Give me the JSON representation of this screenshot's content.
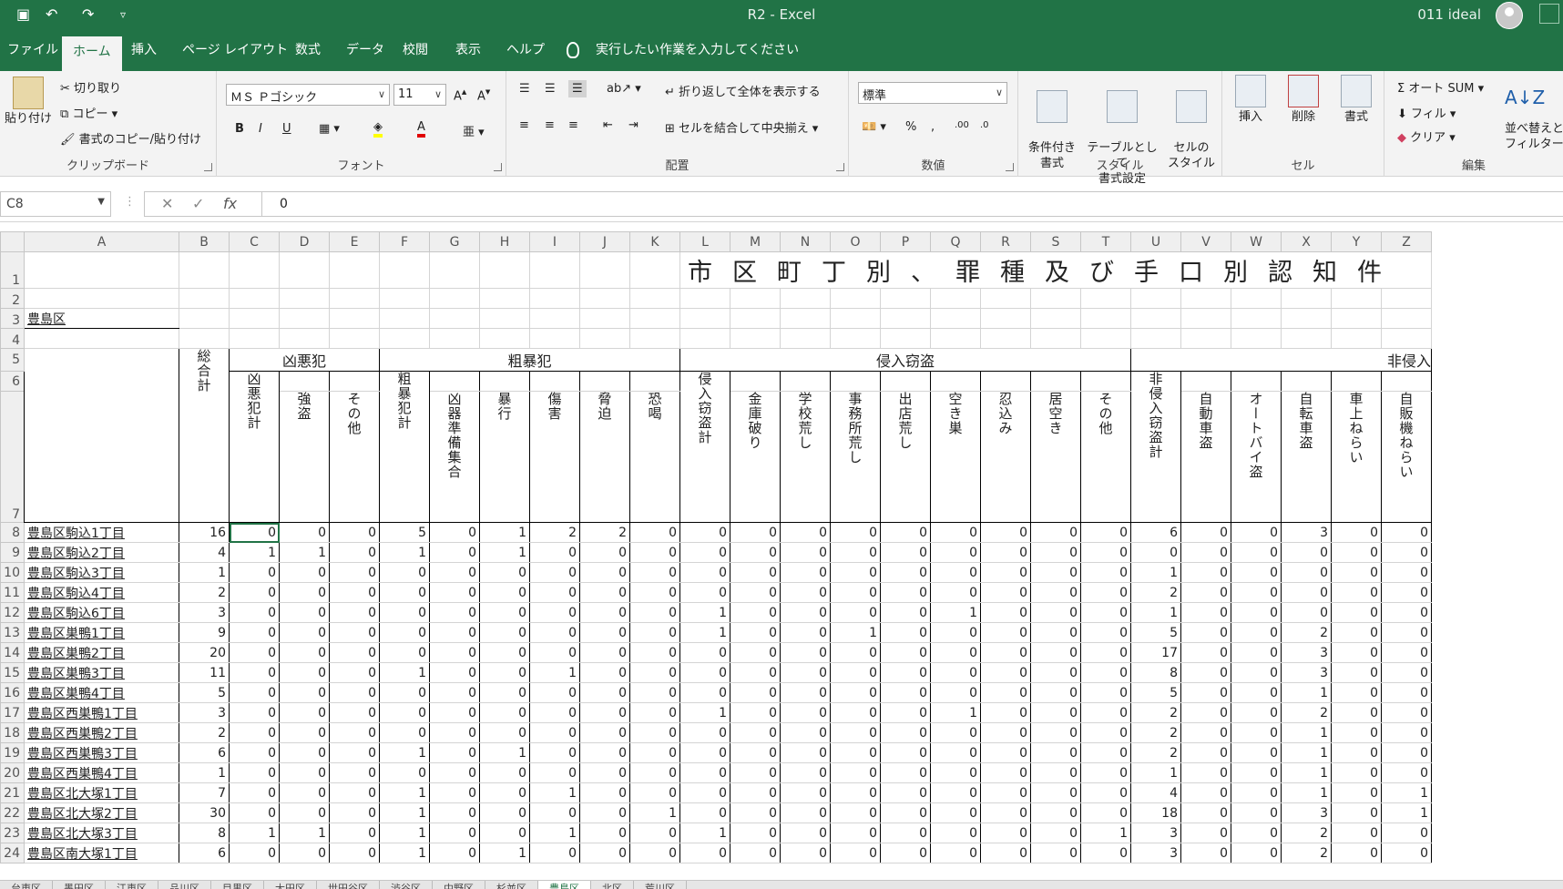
{
  "titlebar": {
    "doc_title": "R2  -  Excel",
    "account": "011 ideal",
    "colors": {
      "bg": "#217346"
    }
  },
  "tabs": [
    "ファイル",
    "ホーム",
    "挿入",
    "ページ レイアウト",
    "数式",
    "データ",
    "校閲",
    "表示",
    "ヘルプ"
  ],
  "tell_me": "実行したい作業を入力してください",
  "ribbon": {
    "clipboard": {
      "paste": "貼り付け",
      "cut": "切り取り",
      "copy": "コピー",
      "format_painter": "書式のコピー/貼り付け",
      "label": "クリップボード"
    },
    "font": {
      "name": "ＭＳ Ｐゴシック",
      "size": "11",
      "bold": "B",
      "italic": "I",
      "underline": "U",
      "label": "フォント"
    },
    "alignment": {
      "wrap": "折り返して全体を表示する",
      "merge": "セルを結合して中央揃え",
      "label": "配置"
    },
    "number": {
      "format": "標準",
      "label": "数値"
    },
    "styles": {
      "conditional": "条件付き\n書式",
      "table": "テーブルとして\n書式設定",
      "cell": "セルの\nスタイル",
      "label": "スタイル"
    },
    "cells": {
      "insert": "挿入",
      "delete": "削除",
      "format": "書式",
      "label": "セル"
    },
    "editing": {
      "autosum": "オート SUM",
      "fill": "フィル",
      "clear": "クリア",
      "sort": "並べ替えと\nフィルター",
      "label": "編集"
    }
  },
  "formula_bar": {
    "name_box": "C8",
    "value": "0"
  },
  "grid": {
    "columns": [
      "A",
      "B",
      "C",
      "D",
      "E",
      "F",
      "G",
      "H",
      "I",
      "J",
      "K",
      "L",
      "M",
      "N",
      "O",
      "P",
      "Q",
      "R",
      "S",
      "T",
      "U",
      "V",
      "W",
      "X",
      "Y",
      "Z"
    ],
    "title": "市区町丁別、罪種及び手口別認知件",
    "ward": "豊島区",
    "groups": {
      "kyoaku": "凶悪犯",
      "sobo": "粗暴犯",
      "shinnyu": "侵入窃盗",
      "hishinnyu": "非侵入"
    },
    "sougoukei": "総合計",
    "subheaders": {
      "C": "凶悪犯計",
      "D": "強盗",
      "E": "その他",
      "F": "粗暴犯計",
      "G": "凶器準備集合",
      "H": "暴行",
      "I": "傷害",
      "J": "脅迫",
      "K": "恐喝",
      "L": "侵入窃盗計",
      "M": "金庫破り",
      "N": "学校荒し",
      "O": "事務所荒し",
      "P": "出店荒し",
      "Q": "空き巣",
      "R": "忍込み",
      "S": "居空き",
      "T": "その他",
      "U": "非侵入窃盗計",
      "V": "自動車盗",
      "W": "オートバイ盗",
      "X": "自転車盗",
      "Y": "車上ねらい",
      "Z": "自販機ねらい"
    },
    "rows": [
      {
        "n": "8",
        "name": "豊島区駒込1丁目",
        "v": [
          16,
          0,
          0,
          0,
          5,
          0,
          1,
          2,
          2,
          0,
          0,
          0,
          0,
          0,
          0,
          0,
          0,
          0,
          0,
          6,
          0,
          0,
          3,
          0,
          0
        ]
      },
      {
        "n": "9",
        "name": "豊島区駒込2丁目",
        "v": [
          4,
          1,
          1,
          0,
          1,
          0,
          1,
          0,
          0,
          0,
          0,
          0,
          0,
          0,
          0,
          0,
          0,
          0,
          0,
          0,
          0,
          0,
          0,
          0,
          0
        ]
      },
      {
        "n": "10",
        "name": "豊島区駒込3丁目",
        "v": [
          1,
          0,
          0,
          0,
          0,
          0,
          0,
          0,
          0,
          0,
          0,
          0,
          0,
          0,
          0,
          0,
          0,
          0,
          0,
          1,
          0,
          0,
          0,
          0,
          0
        ]
      },
      {
        "n": "11",
        "name": "豊島区駒込4丁目",
        "v": [
          2,
          0,
          0,
          0,
          0,
          0,
          0,
          0,
          0,
          0,
          0,
          0,
          0,
          0,
          0,
          0,
          0,
          0,
          0,
          2,
          0,
          0,
          0,
          0,
          0
        ]
      },
      {
        "n": "12",
        "name": "豊島区駒込6丁目",
        "v": [
          3,
          0,
          0,
          0,
          0,
          0,
          0,
          0,
          0,
          0,
          1,
          0,
          0,
          0,
          0,
          1,
          0,
          0,
          0,
          1,
          0,
          0,
          0,
          0,
          0
        ]
      },
      {
        "n": "13",
        "name": "豊島区巣鴨1丁目",
        "v": [
          9,
          0,
          0,
          0,
          0,
          0,
          0,
          0,
          0,
          0,
          1,
          0,
          0,
          1,
          0,
          0,
          0,
          0,
          0,
          5,
          0,
          0,
          2,
          0,
          0
        ]
      },
      {
        "n": "14",
        "name": "豊島区巣鴨2丁目",
        "v": [
          20,
          0,
          0,
          0,
          0,
          0,
          0,
          0,
          0,
          0,
          0,
          0,
          0,
          0,
          0,
          0,
          0,
          0,
          0,
          17,
          0,
          0,
          3,
          0,
          0
        ]
      },
      {
        "n": "15",
        "name": "豊島区巣鴨3丁目",
        "v": [
          11,
          0,
          0,
          0,
          1,
          0,
          0,
          1,
          0,
          0,
          0,
          0,
          0,
          0,
          0,
          0,
          0,
          0,
          0,
          8,
          0,
          0,
          3,
          0,
          0
        ]
      },
      {
        "n": "16",
        "name": "豊島区巣鴨4丁目",
        "v": [
          5,
          0,
          0,
          0,
          0,
          0,
          0,
          0,
          0,
          0,
          0,
          0,
          0,
          0,
          0,
          0,
          0,
          0,
          0,
          5,
          0,
          0,
          1,
          0,
          0
        ]
      },
      {
        "n": "17",
        "name": "豊島区西巣鴨1丁目",
        "v": [
          3,
          0,
          0,
          0,
          0,
          0,
          0,
          0,
          0,
          0,
          1,
          0,
          0,
          0,
          0,
          1,
          0,
          0,
          0,
          2,
          0,
          0,
          2,
          0,
          0
        ]
      },
      {
        "n": "18",
        "name": "豊島区西巣鴨2丁目",
        "v": [
          2,
          0,
          0,
          0,
          0,
          0,
          0,
          0,
          0,
          0,
          0,
          0,
          0,
          0,
          0,
          0,
          0,
          0,
          0,
          2,
          0,
          0,
          1,
          0,
          0
        ]
      },
      {
        "n": "19",
        "name": "豊島区西巣鴨3丁目",
        "v": [
          6,
          0,
          0,
          0,
          1,
          0,
          1,
          0,
          0,
          0,
          0,
          0,
          0,
          0,
          0,
          0,
          0,
          0,
          0,
          2,
          0,
          0,
          1,
          0,
          0
        ]
      },
      {
        "n": "20",
        "name": "豊島区西巣鴨4丁目",
        "v": [
          1,
          0,
          0,
          0,
          0,
          0,
          0,
          0,
          0,
          0,
          0,
          0,
          0,
          0,
          0,
          0,
          0,
          0,
          0,
          1,
          0,
          0,
          1,
          0,
          0
        ]
      },
      {
        "n": "21",
        "name": "豊島区北大塚1丁目",
        "v": [
          7,
          0,
          0,
          0,
          1,
          0,
          0,
          1,
          0,
          0,
          0,
          0,
          0,
          0,
          0,
          0,
          0,
          0,
          0,
          4,
          0,
          0,
          1,
          0,
          1
        ]
      },
      {
        "n": "22",
        "name": "豊島区北大塚2丁目",
        "v": [
          30,
          0,
          0,
          0,
          1,
          0,
          0,
          0,
          0,
          1,
          0,
          0,
          0,
          0,
          0,
          0,
          0,
          0,
          0,
          18,
          0,
          0,
          3,
          0,
          1
        ]
      },
      {
        "n": "23",
        "name": "豊島区北大塚3丁目",
        "v": [
          8,
          1,
          1,
          0,
          1,
          0,
          0,
          1,
          0,
          0,
          1,
          0,
          0,
          0,
          0,
          0,
          0,
          0,
          1,
          3,
          0,
          0,
          2,
          0,
          0
        ]
      },
      {
        "n": "24",
        "name": "豊島区南大塚1丁目",
        "v": [
          6,
          0,
          0,
          0,
          1,
          0,
          1,
          0,
          0,
          0,
          0,
          0,
          0,
          0,
          0,
          0,
          0,
          0,
          0,
          3,
          0,
          0,
          2,
          0,
          0
        ]
      }
    ]
  },
  "sheet_tabs": [
    "台東区",
    "墨田区",
    "江東区",
    "品川区",
    "目黒区",
    "大田区",
    "世田谷区",
    "渋谷区",
    "中野区",
    "杉並区",
    "豊島区",
    "北区",
    "荒川区"
  ],
  "active_sheet": "豊島区"
}
